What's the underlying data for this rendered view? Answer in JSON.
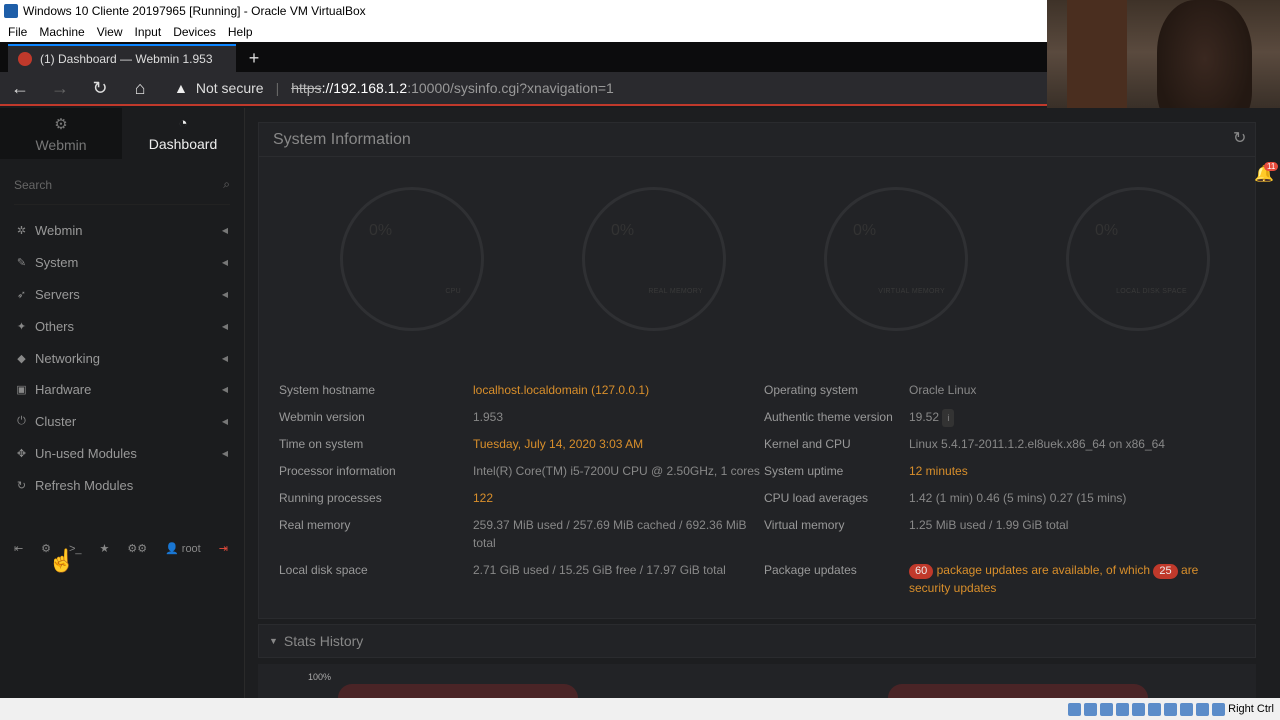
{
  "vbox": {
    "title": "Windows 10 Cliente 20197965 [Running] - Oracle VM VirtualBox",
    "menu": [
      "File",
      "Machine",
      "View",
      "Input",
      "Devices",
      "Help"
    ]
  },
  "browser": {
    "tab_title": "(1) Dashboard — Webmin 1.953",
    "new_tab": "+",
    "security": "Not secure",
    "url_scheme": "https",
    "url_host": "://192.168.1.2",
    "url_rest": ":10000/sysinfo.cgi?xnavigation=1"
  },
  "sidebar": {
    "tabs": [
      {
        "label": "Webmin"
      },
      {
        "label": "Dashboard"
      }
    ],
    "search_placeholder": "Search",
    "items": [
      {
        "label": "Webmin"
      },
      {
        "label": "System"
      },
      {
        "label": "Servers"
      },
      {
        "label": "Others"
      },
      {
        "label": "Networking"
      },
      {
        "label": "Hardware"
      },
      {
        "label": "Cluster"
      },
      {
        "label": "Un-used Modules"
      },
      {
        "label": "Refresh Modules"
      }
    ],
    "user": "root"
  },
  "panel": {
    "title": "System Information",
    "gauges": [
      {
        "pct": "0%",
        "label": "CPU"
      },
      {
        "pct": "0%",
        "label": "REAL MEMORY"
      },
      {
        "pct": "0%",
        "label": "VIRTUAL MEMORY"
      },
      {
        "pct": "0%",
        "label": "LOCAL DISK SPACE"
      }
    ],
    "left": [
      {
        "k": "System hostname",
        "v": "localhost.localdomain (127.0.0.1)"
      },
      {
        "k": "Webmin version",
        "v": "1.953"
      },
      {
        "k": "Time on system",
        "v": "Tuesday, July 14, 2020 3:03 AM"
      },
      {
        "k": "Processor information",
        "v": "Intel(R) Core(TM) i5-7200U CPU @ 2.50GHz, 1 cores"
      },
      {
        "k": "Running processes",
        "v": "122"
      },
      {
        "k": "Real memory",
        "v": "259.37 MiB used / 257.69 MiB cached / 692.36 MiB total"
      },
      {
        "k": "Local disk space",
        "v": "2.71 GiB used / 15.25 GiB free / 17.97 GiB total"
      }
    ],
    "right": [
      {
        "k": "Operating system",
        "v": "Oracle Linux"
      },
      {
        "k": "Authentic theme version",
        "v": "19.52"
      },
      {
        "k": "Kernel and CPU",
        "v": "Linux 5.4.17-2011.1.2.el8uek.x86_64 on x86_64"
      },
      {
        "k": "System uptime",
        "v": "12 minutes"
      },
      {
        "k": "CPU load averages",
        "v": "1.42 (1 min) 0.46 (5 mins) 0.27 (15 mins)"
      },
      {
        "k": "Virtual memory",
        "v": "1.25 MiB used / 1.99 GiB total"
      },
      {
        "k": "Package updates",
        "n1": "60",
        "t1": "package updates are available, of which",
        "n2": "25",
        "t2": "are",
        "t3": "security updates"
      }
    ]
  },
  "stats": {
    "title": "Stats History",
    "y_top": "100%"
  },
  "notifications": {
    "count": "11"
  },
  "taskbar": {
    "right_ctrl": "Right Ctrl"
  }
}
